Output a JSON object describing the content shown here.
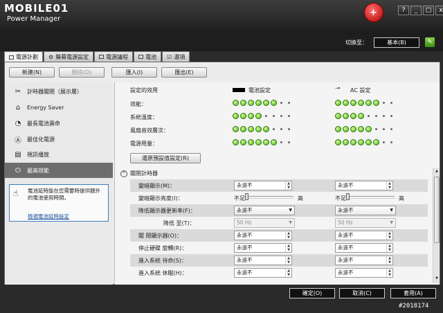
{
  "window": {
    "brand": "MOBILE01",
    "app_title": "Power Manager",
    "logo_glyph": "+",
    "buttons": {
      "help": "?",
      "minimize": "_",
      "maximize": "□",
      "close": "x"
    }
  },
  "header": {
    "switch_label": "切換至：",
    "mode_button": "基本(B)"
  },
  "tabs": [
    {
      "label": "電源計劃",
      "active": true
    },
    {
      "label": "聲幕電源設定",
      "active": false
    },
    {
      "label": "電源議程",
      "active": false
    },
    {
      "label": "電池",
      "active": false
    },
    {
      "label": "選項",
      "active": false
    }
  ],
  "toolbar": {
    "new": "新建(N)",
    "delete": "刪除(D)",
    "import": "匯入(I)",
    "export": "匯出(E)"
  },
  "sidebar": {
    "items": [
      {
        "label": "計時器關閉（展示層）",
        "icon": "timer-icon"
      },
      {
        "label": "Energy Saver",
        "icon": "house-icon"
      },
      {
        "label": "最長電池壽命",
        "icon": "clock-icon"
      },
      {
        "label": "最佳化電源",
        "icon": "circle-a-icon"
      },
      {
        "label": "視訊播放",
        "icon": "film-icon"
      },
      {
        "label": "最高效能",
        "icon": "power-icon",
        "active": true
      }
    ],
    "note": {
      "text": "電池延時能在您需要時提供額外的電池使用時間。",
      "link": "檢視電池延時設定"
    }
  },
  "current": {
    "heading": "設定的效用",
    "battery_col": "電池設定",
    "ac_col": "AC 設定",
    "rows": [
      {
        "label": "效能：",
        "battery": 6,
        "ac": 6
      },
      {
        "label": "系統溫度：",
        "battery": 4,
        "ac": 4
      },
      {
        "label": "風扇音效層次：",
        "battery": 5,
        "ac": 5
      },
      {
        "label": "電源用量：",
        "battery": 6,
        "ac": 6
      }
    ],
    "restore_button": "還原預設值設定(R)"
  },
  "timers": {
    "heading": "關閉計時器",
    "rows": [
      {
        "label": "變暗顯示(M)：",
        "type": "spin",
        "battery": "永遠不",
        "ac": "永遠不"
      },
      {
        "label": "變暗顯示亮度(I)：",
        "type": "slider",
        "low": "不足",
        "high": "高"
      },
      {
        "label": "降低顯示器更新率(F)：",
        "type": "combo",
        "battery": "永遠不",
        "ac": "永遠不"
      },
      {
        "label": "降低 至(T)：",
        "type": "combo-disabled",
        "battery": "50 Hz",
        "ac": "50 Hz"
      },
      {
        "label": "關 閉顯示器(O)：",
        "type": "spin",
        "battery": "永遠不",
        "ac": "永遠不"
      },
      {
        "label": "停止硬碟 旋轉(R)：",
        "type": "spin",
        "battery": "永遠不",
        "ac": "永遠不"
      },
      {
        "label": "進入系統 待命(S)：",
        "type": "spin",
        "battery": "永遠不",
        "ac": "永遠不"
      },
      {
        "label": "進入系統 休眠(H)：",
        "type": "spin",
        "battery": "永遠不",
        "ac": "永遠不"
      }
    ]
  },
  "footer": {
    "ok": "確定(O)",
    "cancel": "取消(C)",
    "apply": "套用(A)"
  },
  "watermark": "#2018174"
}
